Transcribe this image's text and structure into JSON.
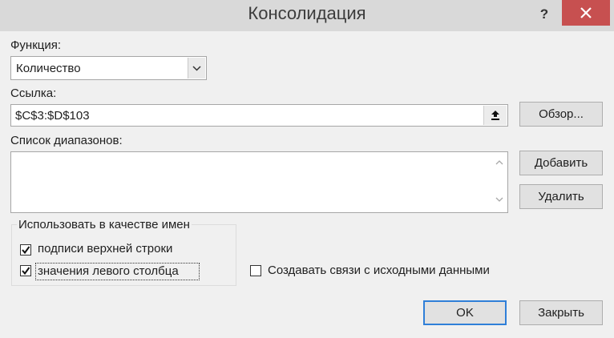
{
  "window": {
    "title": "Консолидация",
    "help_label": "?",
    "close_label": "×"
  },
  "function": {
    "label": "Функция:",
    "label_underline_char": "Ф",
    "selected": "Количество"
  },
  "reference": {
    "label": "Ссылка:",
    "value": "$C$3:$D$103",
    "browse_button": "Обзор..."
  },
  "ranges": {
    "label": "Список диапазонов:",
    "items": [],
    "add_button": "Добавить",
    "delete_button": "Удалить"
  },
  "use_labels": {
    "group_title": "Использовать в качестве имен",
    "top_row": {
      "label": "подписи верхней строки",
      "checked": true
    },
    "left_column": {
      "label": "значения левого столбца",
      "checked": true
    }
  },
  "create_links": {
    "label": "Создавать связи с исходными данными",
    "checked": false
  },
  "footer": {
    "ok_button": "OK",
    "close_button": "Закрыть"
  },
  "colors": {
    "close_button_bg": "#c75050",
    "dialog_bg": "#f0f0f0",
    "ok_border": "#2f7fd8"
  }
}
